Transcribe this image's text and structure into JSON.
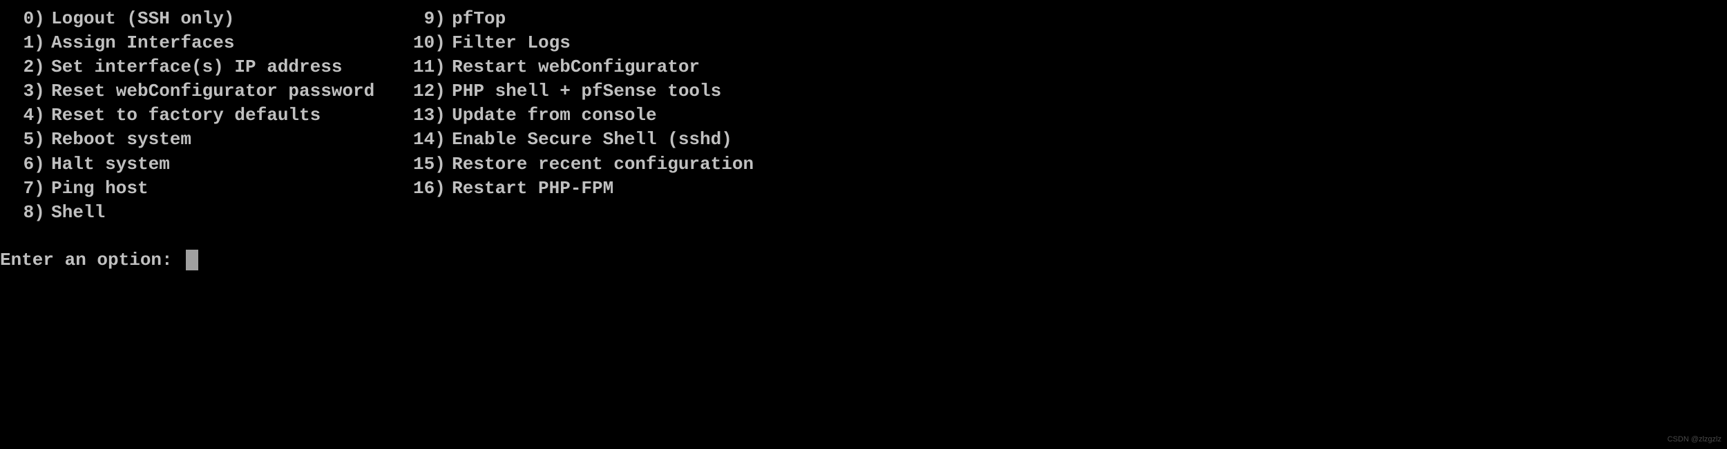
{
  "menu": {
    "left": [
      {
        "num": "0",
        "label": "Logout (SSH only)"
      },
      {
        "num": "1",
        "label": "Assign Interfaces"
      },
      {
        "num": "2",
        "label": "Set interface(s) IP address"
      },
      {
        "num": "3",
        "label": "Reset webConfigurator password"
      },
      {
        "num": "4",
        "label": "Reset to factory defaults"
      },
      {
        "num": "5",
        "label": "Reboot system"
      },
      {
        "num": "6",
        "label": "Halt system"
      },
      {
        "num": "7",
        "label": "Ping host"
      },
      {
        "num": "8",
        "label": "Shell"
      }
    ],
    "right": [
      {
        "num": "9",
        "label": "pfTop"
      },
      {
        "num": "10",
        "label": "Filter Logs"
      },
      {
        "num": "11",
        "label": "Restart webConfigurator"
      },
      {
        "num": "12",
        "label": "PHP shell + pfSense tools"
      },
      {
        "num": "13",
        "label": "Update from console"
      },
      {
        "num": "14",
        "label": "Enable Secure Shell (sshd)"
      },
      {
        "num": "15",
        "label": "Restore recent configuration"
      },
      {
        "num": "16",
        "label": "Restart PHP-FPM"
      }
    ]
  },
  "prompt": {
    "label": "Enter an option: "
  },
  "watermark": "CSDN @zlzgzlz"
}
